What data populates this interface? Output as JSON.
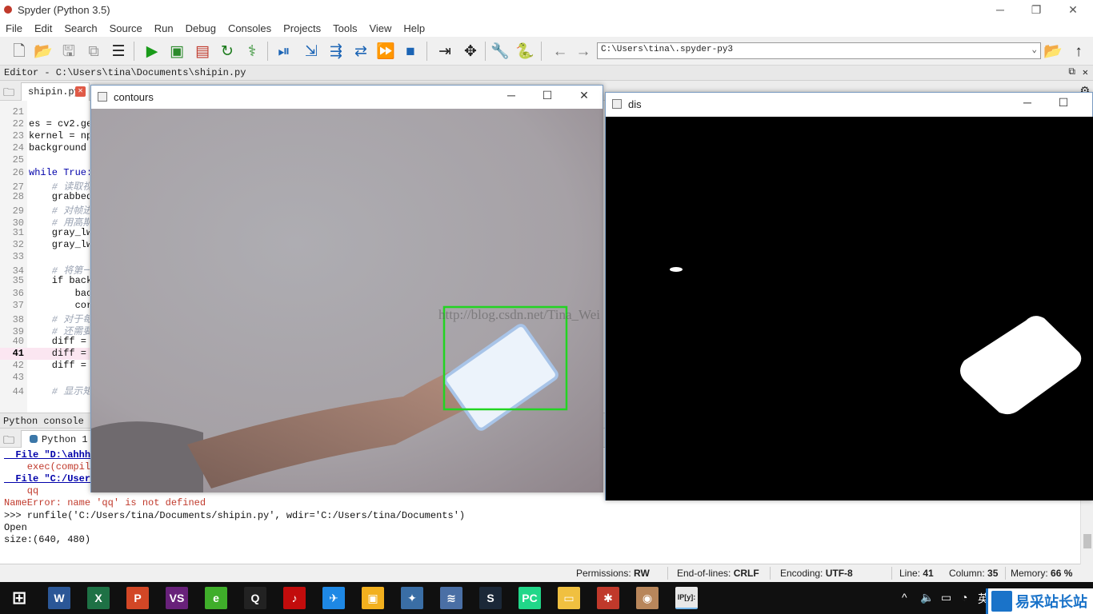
{
  "window": {
    "title": "Spyder (Python 3.5)",
    "min": "─",
    "restore": "❐",
    "close": "✕"
  },
  "menu": [
    "File",
    "Edit",
    "Search",
    "Source",
    "Run",
    "Debug",
    "Consoles",
    "Projects",
    "Tools",
    "View",
    "Help"
  ],
  "toolbar": {
    "path": "C:\\Users\\tina\\.spyder-py3",
    "icons": [
      "new-file-icon",
      "open-file-icon",
      "save-icon",
      "save-all-icon",
      "outline-icon",
      "run-icon",
      "run-cell-icon",
      "run-cell-advance-icon",
      "rerun-icon",
      "debug-icon",
      "debug-step-icon",
      "step-into-icon",
      "step-over-icon",
      "step-return-icon",
      "continue-icon",
      "stop-icon",
      "maximize-pane-icon",
      "fullscreen-icon",
      "preferences-icon",
      "python-path-icon",
      "back-arrow-icon",
      "forward-arrow-icon",
      "browse-folder-icon",
      "parent-dir-icon"
    ]
  },
  "editor": {
    "header": "Editor - C:\\Users\\tina\\Documents\\shipin.py",
    "tab": "shipin.py",
    "current_line": 41,
    "lines": [
      {
        "n": "21",
        "t": "",
        "c": "cd"
      },
      {
        "n": "22",
        "t": "es = cv2.ge",
        "c": "cd"
      },
      {
        "n": "23",
        "t": "kernel = np",
        "c": "cd"
      },
      {
        "n": "24",
        "t": "background",
        "c": "cd"
      },
      {
        "n": "25",
        "t": "",
        "c": "cd"
      },
      {
        "n": "26",
        "t": "while True:",
        "c": "kw"
      },
      {
        "n": "27",
        "t": "    # 读取视",
        "c": "cm"
      },
      {
        "n": "28",
        "t": "    grabbed",
        "c": "cd"
      },
      {
        "n": "29",
        "t": "    # 对帧进",
        "c": "cm"
      },
      {
        "n": "30",
        "t": "    # 用高斯",
        "c": "cm"
      },
      {
        "n": "31",
        "t": "    gray_lw",
        "c": "cd"
      },
      {
        "n": "32",
        "t": "    gray_lw",
        "c": "cd"
      },
      {
        "n": "33",
        "t": "",
        "c": "cd"
      },
      {
        "n": "34",
        "t": "    # 将第一",
        "c": "cm"
      },
      {
        "n": "35",
        "t": "    if back",
        "c": "cd"
      },
      {
        "n": "36",
        "t": "        bac",
        "c": "cd"
      },
      {
        "n": "37",
        "t": "        cor",
        "c": "cd"
      },
      {
        "n": "38",
        "t": "    # 对于每",
        "c": "cm"
      },
      {
        "n": "39",
        "t": "    # 还需要",
        "c": "cm"
      },
      {
        "n": "40",
        "t": "    diff =",
        "c": "cd"
      },
      {
        "n": "41",
        "t": "    diff =",
        "c": "cd"
      },
      {
        "n": "42",
        "t": "    diff =",
        "c": "cd"
      },
      {
        "n": "43",
        "t": "",
        "c": "cd"
      },
      {
        "n": "44",
        "t": "    # 显示矩",
        "c": "cm"
      }
    ]
  },
  "console": {
    "header": "Python console",
    "tab": "Python 1",
    "lines": [
      {
        "t": "  File \"D:\\ahhhh",
        "c": "link"
      },
      {
        "t": "    exec(compile",
        "c": "err"
      },
      {
        "t": "  File \"C:/User",
        "c": "link"
      },
      {
        "t": "    qq",
        "c": "err"
      },
      {
        "t": "NameError: name 'qq' is not defined",
        "c": "err"
      },
      {
        "t": ">>> runfile('C:/Users/tina/Documents/shipin.py', wdir='C:/Users/tina/Documents')",
        "c": "cd"
      },
      {
        "t": "Open",
        "c": "cd"
      },
      {
        "t": "size:(640, 480)",
        "c": "cd"
      }
    ]
  },
  "statusbar": {
    "permissions_label": "Permissions:",
    "permissions": "RW",
    "eol_label": "End-of-lines:",
    "eol": "CRLF",
    "encoding_label": "Encoding:",
    "encoding": "UTF-8",
    "line_label": "Line:",
    "line": "41",
    "column_label": "Column:",
    "column": "35",
    "memory_label": "Memory:",
    "memory": "66 %"
  },
  "cv_windows": {
    "contours_title": "contours",
    "dis_title": "dis",
    "watermark": "http://blog.csdn.net/Tina_Wei"
  },
  "taskbar": {
    "apps": [
      {
        "name": "windows-start-icon",
        "label": "⊞",
        "color": "#101010"
      },
      {
        "name": "word-icon",
        "label": "W",
        "color": "#2b5797"
      },
      {
        "name": "excel-icon",
        "label": "X",
        "color": "#1e7145"
      },
      {
        "name": "powerpoint-icon",
        "label": "P",
        "color": "#d24726"
      },
      {
        "name": "visual-studio-icon",
        "label": "VS",
        "color": "#68217a"
      },
      {
        "name": "browser-icon",
        "label": "e",
        "color": "#3fae2a"
      },
      {
        "name": "qq-icon",
        "label": "Q",
        "color": "#222"
      },
      {
        "name": "netease-music-icon",
        "label": "♪",
        "color": "#c20c0c"
      },
      {
        "name": "feishu-icon",
        "label": "✈",
        "color": "#1e88e5"
      },
      {
        "name": "photo-app-icon",
        "label": "▣",
        "color": "#f2b01e"
      },
      {
        "name": "vpn-icon",
        "label": "✦",
        "color": "#3a6ea5"
      },
      {
        "name": "stack-app-icon",
        "label": "≋",
        "color": "#4a6fa5"
      },
      {
        "name": "steam-icon",
        "label": "S",
        "color": "#1b2838"
      },
      {
        "name": "pycharm-icon",
        "label": "PC",
        "color": "#21d789"
      },
      {
        "name": "file-explorer-icon",
        "label": "▭",
        "color": "#f0c040"
      },
      {
        "name": "spider-app-icon",
        "label": "✱",
        "color": "#c0392b"
      },
      {
        "name": "camera-app-icon",
        "label": "◉",
        "color": "#b8865b"
      },
      {
        "name": "ipython-icon",
        "label": "IP[y]:",
        "color": "#e8e8e8"
      }
    ],
    "tray": {
      "chevron": "^",
      "volume": "🔈",
      "battery": "▭",
      "wifi": "◔",
      "ime": "英"
    },
    "stamp": "易采站长站"
  }
}
